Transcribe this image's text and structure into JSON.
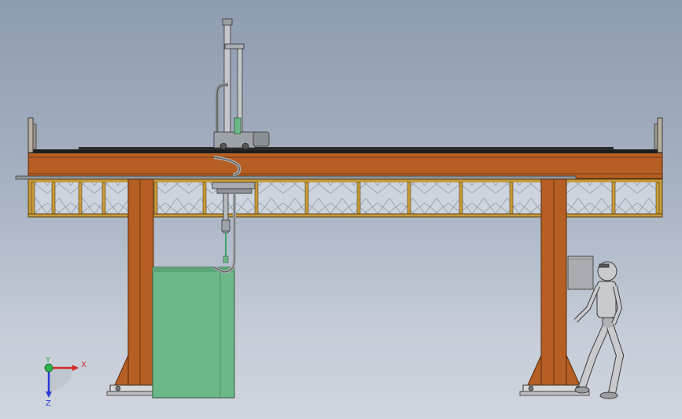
{
  "axis_triad": {
    "x_label": "X",
    "y_label": "Y",
    "z_label": "Z"
  },
  "colors": {
    "beam": "#b55f24",
    "beam_dark": "#6e3310",
    "truss_frame": "#c79a3a",
    "truss_panel": "#c9d1dc",
    "column": "#b55f24",
    "machine_tank": "#6db888",
    "cabinet": "#a9acb0",
    "rail": "#1d1d1d",
    "steel": "#8f949a"
  },
  "icons": {
    "triad": "axis-triad-icon",
    "human": "human-figure-icon"
  }
}
